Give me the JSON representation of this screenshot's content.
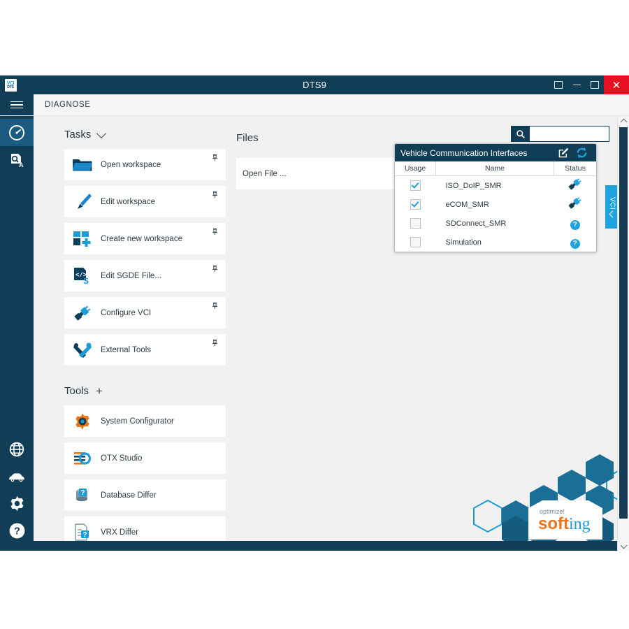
{
  "window": {
    "title": "DTS9",
    "app_icon": "dts-logo-icon",
    "controls": {
      "restore_label": "restore-icon",
      "minimize_label": "minimize-icon",
      "maximize_label": "maximize-icon",
      "close_label": "✕"
    }
  },
  "menubar": {
    "hamburger": "menu-icon",
    "label": "DIAGNOSE"
  },
  "sidebar": {
    "top_items": [
      {
        "name": "diagnose",
        "icon": "gauge-icon",
        "active": true
      },
      {
        "name": "analyze",
        "icon": "document-search-a-icon",
        "active": false
      }
    ],
    "bottom_items": [
      {
        "name": "network",
        "icon": "globe-icon"
      },
      {
        "name": "vehicle",
        "icon": "car-icon"
      },
      {
        "name": "settings",
        "icon": "gear-icon"
      },
      {
        "name": "help",
        "icon": "question-icon"
      }
    ]
  },
  "tasks": {
    "heading": "Tasks",
    "collapse_icon": "chevron-down-icon",
    "items": [
      {
        "label": "Open workspace",
        "icon": "folder-icon",
        "pin": "pin-icon"
      },
      {
        "label": "Edit workspace",
        "icon": "brush-icon",
        "pin": "pin-icon"
      },
      {
        "label": "Create new workspace",
        "icon": "new-workspace-icon",
        "pin": "pin-icon"
      },
      {
        "label": "Edit SGDE File...",
        "icon": "code-file-icon",
        "pin": "pin-icon"
      },
      {
        "label": "Configure VCI",
        "icon": "plug-connector-icon",
        "pin": "pin-icon"
      },
      {
        "label": "External Tools",
        "icon": "tools-icon",
        "pin": "pin-icon"
      }
    ]
  },
  "tools": {
    "heading": "Tools",
    "add_icon": "plus-icon",
    "items": [
      {
        "label": "System Configurator",
        "icon": "gear-orange-icon"
      },
      {
        "label": "OTX Studio",
        "icon": "otx-icon"
      },
      {
        "label": "Database Differ",
        "icon": "database-question-icon"
      },
      {
        "label": "VRX Differ",
        "icon": "document-question-icon"
      }
    ]
  },
  "files": {
    "heading": "Files",
    "open_file_label": "Open File ...",
    "search": {
      "icon": "search-icon",
      "value": "",
      "placeholder": ""
    }
  },
  "vci_tab": {
    "label": "VCI",
    "chevron": "chevron-left-icon"
  },
  "vci_dialog": {
    "title": "Vehicle Communication Interfaces",
    "edit_icon": "edit-pencil-icon",
    "refresh_icon": "refresh-icon",
    "columns": [
      "Usage",
      "Name",
      "Status"
    ],
    "rows": [
      {
        "usage": true,
        "name": "ISO_DoIP_SMR",
        "status_icon": "plug-connected-icon"
      },
      {
        "usage": true,
        "name": "eCOM_SMR",
        "status_icon": "plug-connected-icon"
      },
      {
        "usage": false,
        "name": "SDConnect_SMR",
        "status_icon": "question-icon"
      },
      {
        "usage": false,
        "name": "Simulation",
        "status_icon": "question-icon"
      }
    ]
  },
  "branding": {
    "tagline": "optimize!",
    "name_bold": "soft",
    "name_light": "ing"
  },
  "scrollbar": {
    "up_icon": "chevron-up-icon",
    "down_icon": "chevron-down-icon"
  },
  "colors": {
    "brand_dark": "#123d56",
    "accent_blue": "#1fa3e0",
    "close_red": "#e81123",
    "panel_bg": "#f1f1f1"
  }
}
